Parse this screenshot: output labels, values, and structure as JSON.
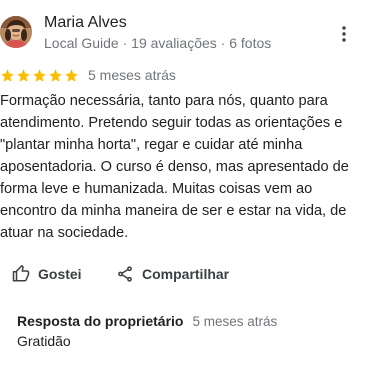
{
  "reviewer": {
    "name": "Maria Alves",
    "meta": "Local Guide · 19 avaliações · 6 fotos",
    "avatar_icon": "profile-photo"
  },
  "review": {
    "rating": 5,
    "rating_max": 5,
    "star_color": "#fbbc04",
    "date": "5 meses atrás",
    "text": "Formação necessária, tanto para nós, quanto para atendimento. Pretendo seguir todas as orientações e \"plantar minha horta\", regar e cuidar até minha aposentadoria. O curso é denso, mas apresentado de forma leve e humanizada. Muitas coisas vem ao encontro da minha maneira de ser e estar na vida, de atuar na sociedade."
  },
  "actions": {
    "like_label": "Gostei",
    "like_icon": "thumb-up-icon",
    "share_label": "Compartilhar",
    "share_icon": "share-icon",
    "more_icon": "more-vert-icon"
  },
  "owner_response": {
    "title": "Resposta do proprietário",
    "date": "5 meses atrás",
    "text": "Gratidão"
  }
}
